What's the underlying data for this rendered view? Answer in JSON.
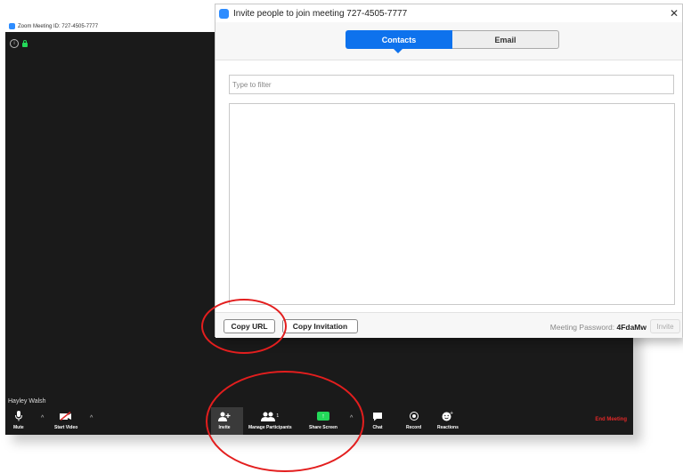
{
  "meeting_window": {
    "title": "Zoom Meeting ID: 727-4505-7777",
    "participant_name": "Hayley Walsh"
  },
  "toolbar": {
    "mute_label": "Mute",
    "start_video_label": "Start Video",
    "invite_label": "Invite",
    "manage_participants_label": "Manage Participants",
    "participant_count": "1",
    "share_screen_label": "Share Screen",
    "chat_label": "Chat",
    "record_label": "Record",
    "reactions_label": "Reactions",
    "end_meeting_label": "End Meeting"
  },
  "invite_dialog": {
    "title": "Invite people to join meeting 727-4505-7777",
    "close_glyph": "✕",
    "tabs": [
      {
        "label": "Contacts",
        "active": true
      },
      {
        "label": "Email",
        "active": false
      }
    ],
    "filter_placeholder": "Type to filter",
    "copy_url_label": "Copy URL",
    "copy_invitation_label": "Copy Invitation",
    "password_label": "Meeting Password:",
    "password_value": "4FdaMw",
    "invite_button_label": "Invite"
  },
  "colors": {
    "zoom_blue": "#0e72ed",
    "share_green": "#23d959",
    "end_red": "#e02828",
    "annotation_red": "#e31e1e"
  }
}
